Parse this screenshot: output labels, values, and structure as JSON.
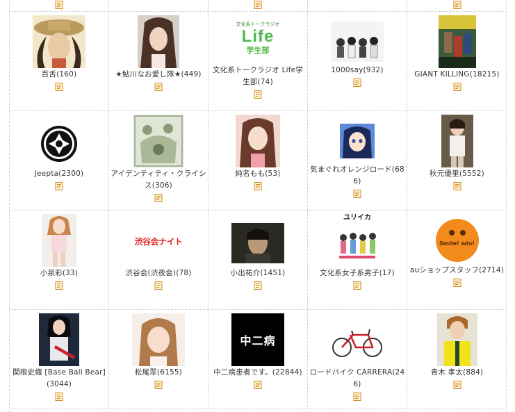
{
  "colors": {
    "border": "#c8c8c8",
    "text": "#333333",
    "icon_fill": "#fff3d6",
    "icon_stroke": "#d18a1e"
  },
  "top_row": {
    "icons": [
      "memo-icon",
      "memo-icon",
      "memo-icon"
    ]
  },
  "rows": [
    [
      {
        "label": "百舌(160)",
        "icon": "memo-icon"
      },
      {
        "label": "★鮎川なお愛し隊★(449)",
        "icon": "memo-icon"
      },
      {
        "label": "文化系トークラジオ Life学生部(74)",
        "icon": "memo-icon",
        "logo_small": "文化系トークラジオ",
        "logo_big": "Life",
        "logo_sub": "学生部"
      },
      {
        "label": "1000say(932)",
        "icon": "memo-icon"
      },
      {
        "label": "GIANT KILLING(18215)",
        "icon": "memo-icon"
      }
    ],
    [
      {
        "label": "Jeepta(2300)",
        "icon": "memo-icon"
      },
      {
        "label": "アイデンティティ・クライシス(306)",
        "icon": "memo-icon"
      },
      {
        "label": "純名もも(53)",
        "icon": "memo-icon"
      },
      {
        "label": "気まぐれオレンジロード(686)",
        "icon": "memo-icon"
      },
      {
        "label": "秋元優里(5552)",
        "icon": "memo-icon"
      }
    ],
    [
      {
        "label": "小泉彩(33)",
        "icon": "memo-icon"
      },
      {
        "label": "渋谷会(渋夜会)(78)",
        "icon": "memo-icon",
        "logo_text": "渋谷会ナイト"
      },
      {
        "label": "小出祐介(1451)",
        "icon": "memo-icon"
      },
      {
        "label": "文化系女子系男子(17)",
        "icon": "memo-icon",
        "logo_text": "ユリイカ"
      },
      {
        "label": "auショップスタッフ(2714)",
        "icon": "memo-icon",
        "logo_text": "Smile! win!"
      }
    ],
    [
      {
        "label": "関根史織 [Base Ball Bear](3044)",
        "icon": "memo-icon"
      },
      {
        "label": "松尾翠(6155)",
        "icon": "memo-icon"
      },
      {
        "label": "中二病患者です。(22844)",
        "icon": "memo-icon",
        "logo_text": "中二病"
      },
      {
        "label": "ロードバイク CARRERA(246)",
        "icon": "memo-icon"
      },
      {
        "label": "青木 孝太(884)",
        "icon": "memo-icon"
      }
    ]
  ]
}
